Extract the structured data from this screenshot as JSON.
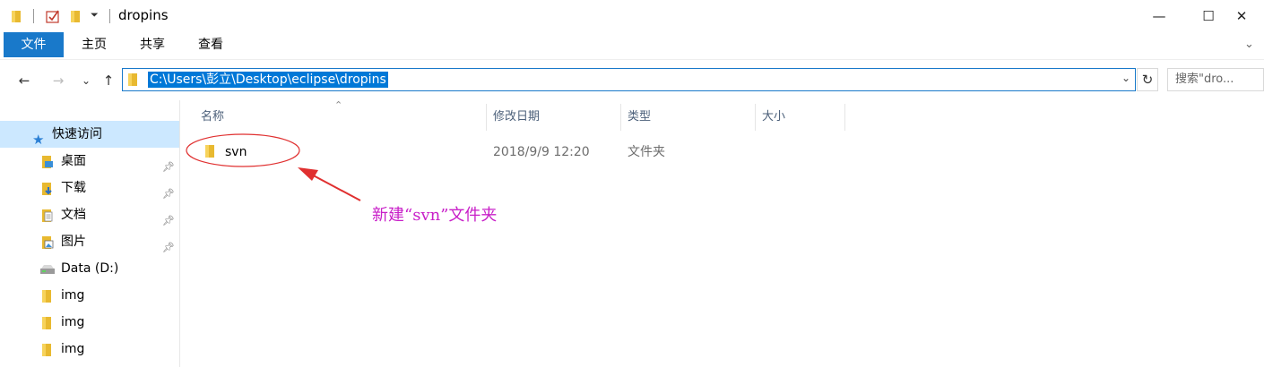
{
  "window": {
    "title": "dropins",
    "controls": {
      "minimize": "—",
      "maximize": "☐",
      "close": "✕"
    }
  },
  "ribbon": {
    "tabs": [
      {
        "label": "文件",
        "active": true
      },
      {
        "label": "主页"
      },
      {
        "label": "共享"
      },
      {
        "label": "查看"
      }
    ]
  },
  "toolbar": {
    "back": "←",
    "forward": "→",
    "recent": "⌄",
    "up": "↑",
    "address": "C:\\Users\\彭立\\Desktop\\eclipse\\dropins",
    "refresh": "↻",
    "search_placeholder": "搜索\"dro...",
    "search_icon": "⌕"
  },
  "nav_pane": {
    "quick_access": "快速访问",
    "items": [
      {
        "label": "桌面",
        "icon": "desktop-folder-icon",
        "pinned": true
      },
      {
        "label": "下载",
        "icon": "downloads-folder-icon",
        "pinned": true
      },
      {
        "label": "文档",
        "icon": "documents-folder-icon",
        "pinned": true
      },
      {
        "label": "图片",
        "icon": "pictures-folder-icon",
        "pinned": true
      },
      {
        "label": "Data (D:)",
        "icon": "drive-icon",
        "pinned": false
      },
      {
        "label": "img",
        "icon": "folder-icon",
        "pinned": false
      },
      {
        "label": "img",
        "icon": "folder-icon",
        "pinned": false
      },
      {
        "label": "img",
        "icon": "folder-icon",
        "pinned": false
      }
    ]
  },
  "file_list": {
    "columns": [
      "名称",
      "修改日期",
      "类型",
      "大小"
    ],
    "rows": [
      {
        "name": "svn",
        "modified": "2018/9/9 12:20",
        "type": "文件夹",
        "size": ""
      }
    ]
  },
  "annotation": {
    "text": "新建“svn”文件夹"
  },
  "colors": {
    "accent": "#1979ca",
    "selection": "#cce8ff",
    "annotation": "#c81ec8",
    "annotation_ellipse": "#e03030"
  }
}
